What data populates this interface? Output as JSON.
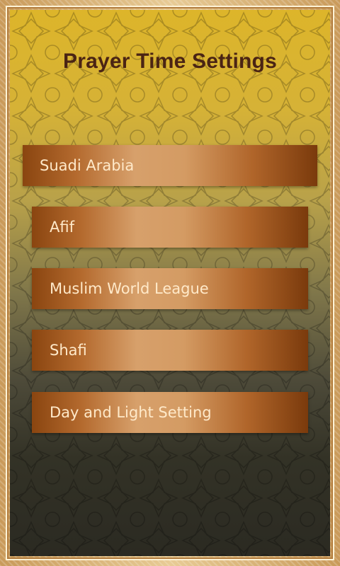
{
  "header": {
    "title": "Prayer Time Settings"
  },
  "menu": {
    "items": [
      {
        "label": "Suadi Arabia"
      },
      {
        "label": "Afif"
      },
      {
        "label": "Muslim World League"
      },
      {
        "label": "Shafi"
      },
      {
        "label": "Day and Light Setting"
      }
    ]
  },
  "colors": {
    "title": "#4a2414",
    "item_text": "#ffe9c9",
    "item_dark": "#8a4510",
    "item_light": "#d7a06b",
    "background_top": "#ddb52a",
    "background_bottom": "#2b2a22",
    "frame": "#e8cb95"
  }
}
